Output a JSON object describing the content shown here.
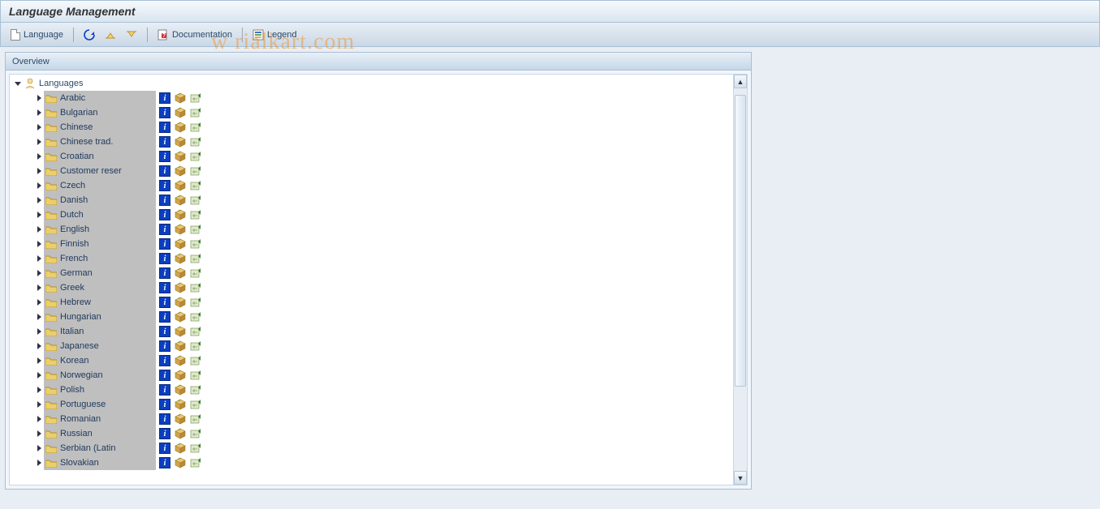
{
  "header": {
    "title": "Language Management"
  },
  "toolbar": {
    "language_label": "Language",
    "documentation_label": "Documentation",
    "legend_label": "Legend"
  },
  "panel": {
    "title": "Overview"
  },
  "tree": {
    "root_label": "Languages",
    "languages": [
      "Arabic",
      "Bulgarian",
      "Chinese",
      "Chinese trad.",
      "Croatian",
      "Customer reser",
      "Czech",
      "Danish",
      "Dutch",
      "English",
      "Finnish",
      "French",
      "German",
      "Greek",
      "Hebrew",
      "Hungarian",
      "Italian",
      "Japanese",
      "Korean",
      "Norwegian",
      "Polish",
      "Portuguese",
      "Romanian",
      "Russian",
      "Serbian (Latin",
      "Slovakian"
    ]
  },
  "watermark": "w     rialkart.com"
}
